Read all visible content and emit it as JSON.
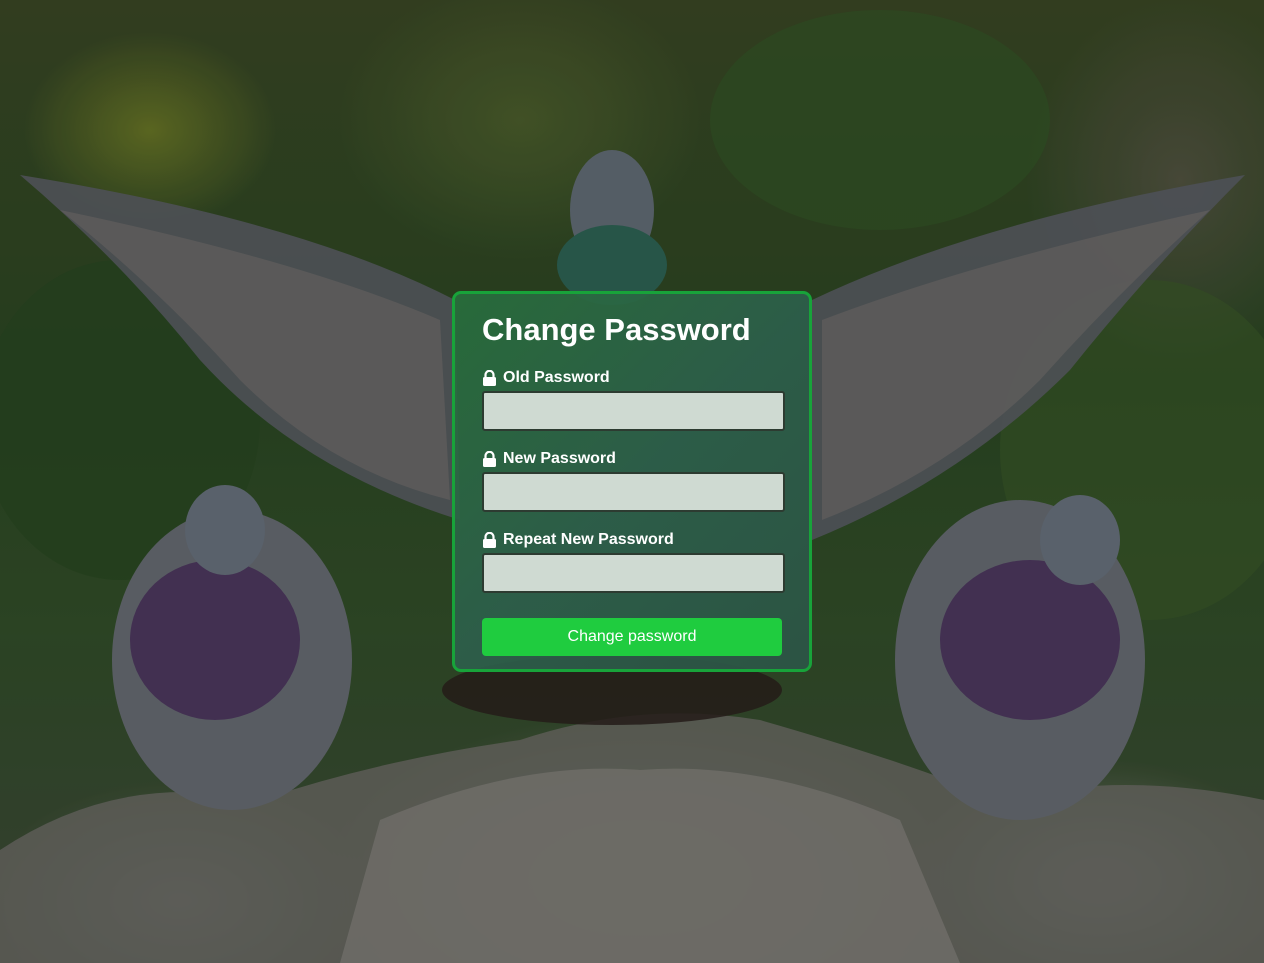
{
  "form": {
    "title": "Change Password",
    "fields": [
      {
        "label": "Old Password",
        "icon": "lock-icon",
        "value": "",
        "placeholder": ""
      },
      {
        "label": "New Password",
        "icon": "lock-icon",
        "value": "",
        "placeholder": ""
      },
      {
        "label": "Repeat New Password",
        "icon": "lock-icon",
        "value": "",
        "placeholder": ""
      }
    ],
    "submit_label": "Change password"
  },
  "background": {
    "description_icon": "pigeons-photo",
    "colors": {
      "card_border": "#18a33a",
      "button": "#1fcc3f",
      "input_bg": "#cfdad2"
    }
  }
}
